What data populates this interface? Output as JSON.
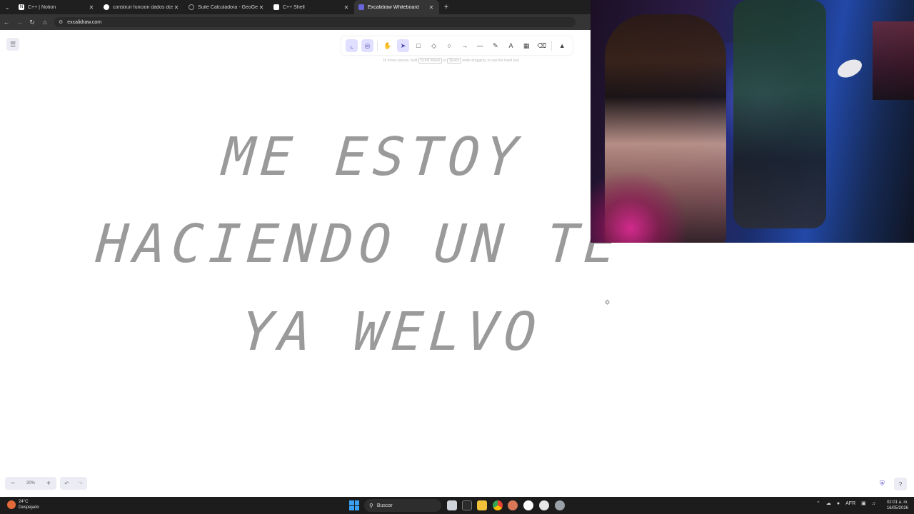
{
  "browser": {
    "tabs": [
      {
        "title": "C++ | Notion",
        "fav_color": "#ffffff",
        "active": false
      },
      {
        "title": "construir funcion dados dos pu",
        "fav_color": "#ffffff",
        "active": false
      },
      {
        "title": "Suite Calculadora - GeoGebra",
        "fav_color": "#9a9a9a",
        "active": false
      },
      {
        "title": "C++ Shell",
        "fav_color": "#ffffff",
        "active": false
      },
      {
        "title": "Excalidraw Whiteboard",
        "fav_color": "#6965db",
        "active": true
      }
    ],
    "url": "excalidraw.com"
  },
  "canvas": {
    "hint": {
      "pre": "To move canvas, hold",
      "key1": "Scroll wheel",
      "mid": "or",
      "key2": "Space",
      "post": "while dragging, or use the hand tool"
    },
    "text_lines": [
      "ME ESTOY",
      "HACIENDO UN TE",
      "YA WELVO"
    ],
    "zoom": "30%"
  },
  "taskbar": {
    "weather_temp": "24°C",
    "weather_desc": "Despejado",
    "search_placeholder": "Buscar",
    "lang": "AFR",
    "time": "02:01 a. m.",
    "date": "16/05/2026"
  },
  "colors": {
    "accent": "#6965db",
    "text_stroke": "#9a9a9a"
  }
}
